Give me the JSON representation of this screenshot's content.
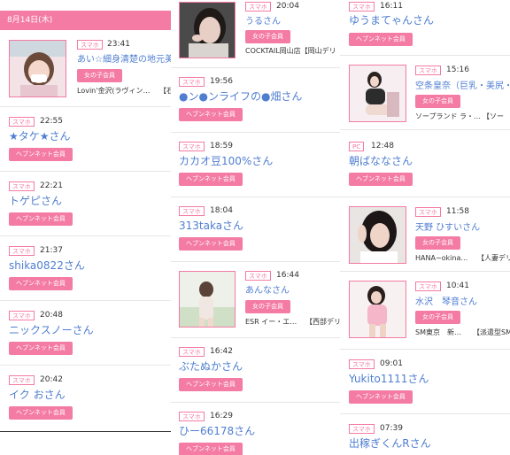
{
  "date_header": "8月14日(木)",
  "labels": {
    "device": "スマホ",
    "device_pc": "PC",
    "member_heaven": "ヘブンネット会員",
    "member_girl": "女の子会員"
  },
  "col1": [
    {
      "time": "23:41",
      "name": "あい☆細身清楚の地元美",
      "member": "女の子会員",
      "shop": "Lovin'金沢(ラヴィン…",
      "shop2": "【石"
    },
    {
      "time": "22:55",
      "name": "★タケ★さん",
      "member": "ヘブンネット会員"
    },
    {
      "time": "22:21",
      "name": "トゲピさん",
      "member": "ヘブンネット会員"
    },
    {
      "time": "21:37",
      "name": "shika0822さん",
      "member": "ヘブンネット会員"
    },
    {
      "time": "20:48",
      "name": "ニックスノーさん",
      "member": "ヘブンネット会員"
    },
    {
      "time": "20:42",
      "name": "イク おさん",
      "member": "ヘブンネット会員"
    }
  ],
  "col2": [
    {
      "time": "20:04",
      "name": "うるさん",
      "member": "女の子会員",
      "shop": "COCKTAIL岡山店【岡山デリ"
    },
    {
      "time": "19:56",
      "name": "●ン●ンライフの●畑さん",
      "member": "ヘブンネット会員"
    },
    {
      "time": "18:59",
      "name": "カカオ豆100%さん",
      "member": "ヘブンネット会員"
    },
    {
      "time": "18:04",
      "name": "313takaさん",
      "member": "ヘブンネット会員"
    },
    {
      "time": "16:44",
      "name": "あんなさん",
      "member": "女の子会員",
      "shop": "ESR イー・エ…",
      "shop2": "【西部デリ"
    },
    {
      "time": "16:42",
      "name": "ぶたぬかさん",
      "member": "ヘブンネット会員"
    },
    {
      "time": "16:29",
      "name": "ひー66178さん",
      "member": "ヘブンネット会員"
    }
  ],
  "col3": [
    {
      "time": "16:11",
      "name": "ゆうまてゃんさん",
      "member": "ヘブンネット会員"
    },
    {
      "time": "15:16",
      "name": "空条皇奈（巨乳・美尻・",
      "member": "女の子会員",
      "shop": "ソープランド ラ・…",
      "shop2": "【ソー"
    },
    {
      "time": "12:48",
      "name": "朝ばななさん",
      "member": "ヘブンネット会員"
    },
    {
      "time": "11:58",
      "name": "天野 ひすいさん",
      "member": "女の子会員",
      "shop": "HANA−okina…",
      "shop2": "【人妻デリ"
    },
    {
      "time": "10:41",
      "name": "水沢　琴音さん",
      "member": "女の子会員",
      "shop": "SM東京　新…",
      "shop2": "【派遣型SM"
    },
    {
      "time": "09:01",
      "name": "Yukito1111さん",
      "member": "ヘブンネット会員"
    },
    {
      "time": "07:39",
      "name": "出稼ぎくんRさん",
      "member": "ヘブンネット会員"
    }
  ],
  "colors": {
    "accent": "#f47ba3",
    "name": "#4f7ed1"
  }
}
